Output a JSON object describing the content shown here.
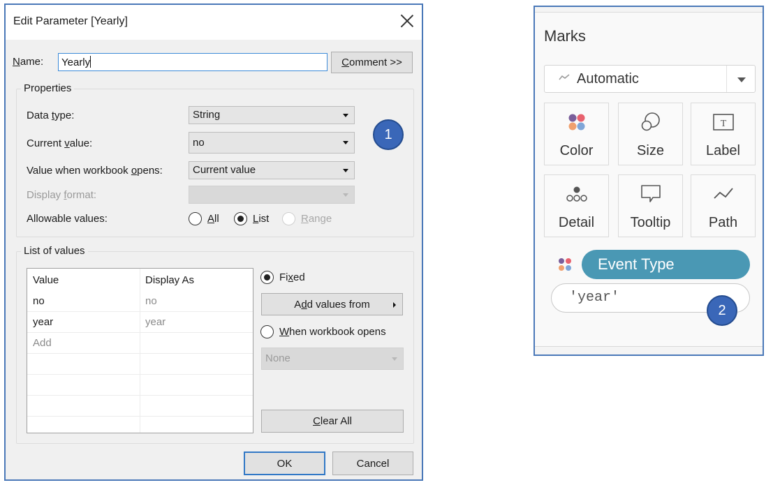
{
  "dialog": {
    "title": "Edit Parameter [Yearly]",
    "name_label_u": "N",
    "name_label_rest": "ame:",
    "name_value": "Yearly",
    "comment_button_u": "C",
    "comment_button_rest": "omment >>",
    "properties": {
      "legend": "Properties",
      "data_type_label_pre": "Data ",
      "data_type_label_u": "t",
      "data_type_label_post": "ype:",
      "data_type_value": "String",
      "current_value_label_pre": "Current ",
      "current_value_label_u": "v",
      "current_value_label_post": "alue:",
      "current_value_value": "no",
      "workbook_opens_label_pre": "Value when workbook ",
      "workbook_opens_label_u": "o",
      "workbook_opens_label_post": "pens:",
      "workbook_opens_value": "Current value",
      "display_format_label_pre": "Display ",
      "display_format_label_u": "f",
      "display_format_label_post": "ormat:",
      "display_format_value": "",
      "allowable_label": "Allowable values:",
      "allowable_options": [
        {
          "u": "A",
          "rest": "ll",
          "checked": false,
          "disabled": false
        },
        {
          "u": "L",
          "rest": "ist",
          "checked": true,
          "disabled": false
        },
        {
          "u": "R",
          "rest": "ange",
          "checked": false,
          "disabled": true
        }
      ]
    },
    "list_of_values": {
      "legend": "List of values",
      "columns": [
        "Value",
        "Display As"
      ],
      "rows": [
        {
          "value": "no",
          "display_as": "no"
        },
        {
          "value": "year",
          "display_as": "year"
        }
      ],
      "add_placeholder": "Add",
      "fixed_label_pre": "Fi",
      "fixed_label_u": "x",
      "fixed_label_post": "ed",
      "add_values_from_pre": "A",
      "add_values_from_u": "d",
      "add_values_from_post": "d values from",
      "when_opens_u": "W",
      "when_opens_rest": "hen workbook opens",
      "when_opens_value": "None",
      "clear_all_u": "C",
      "clear_all_rest": "lear All"
    },
    "ok_label": "OK",
    "cancel_label": "Cancel"
  },
  "annotations": {
    "badge1": "1",
    "badge2": "2",
    "badge_color": "#3a67b8"
  },
  "marks": {
    "title": "Marks",
    "mark_type": "Automatic",
    "cards": [
      {
        "label": "Color",
        "icon": "color-icon"
      },
      {
        "label": "Size",
        "icon": "size-icon"
      },
      {
        "label": "Label",
        "icon": "label-icon"
      },
      {
        "label": "Detail",
        "icon": "detail-icon"
      },
      {
        "label": "Tooltip",
        "icon": "tooltip-icon"
      },
      {
        "label": "Path",
        "icon": "path-icon"
      }
    ],
    "color_pill": "Event Type",
    "color_pill_bg": "#4a98b4",
    "calc_pill": "'year'"
  }
}
